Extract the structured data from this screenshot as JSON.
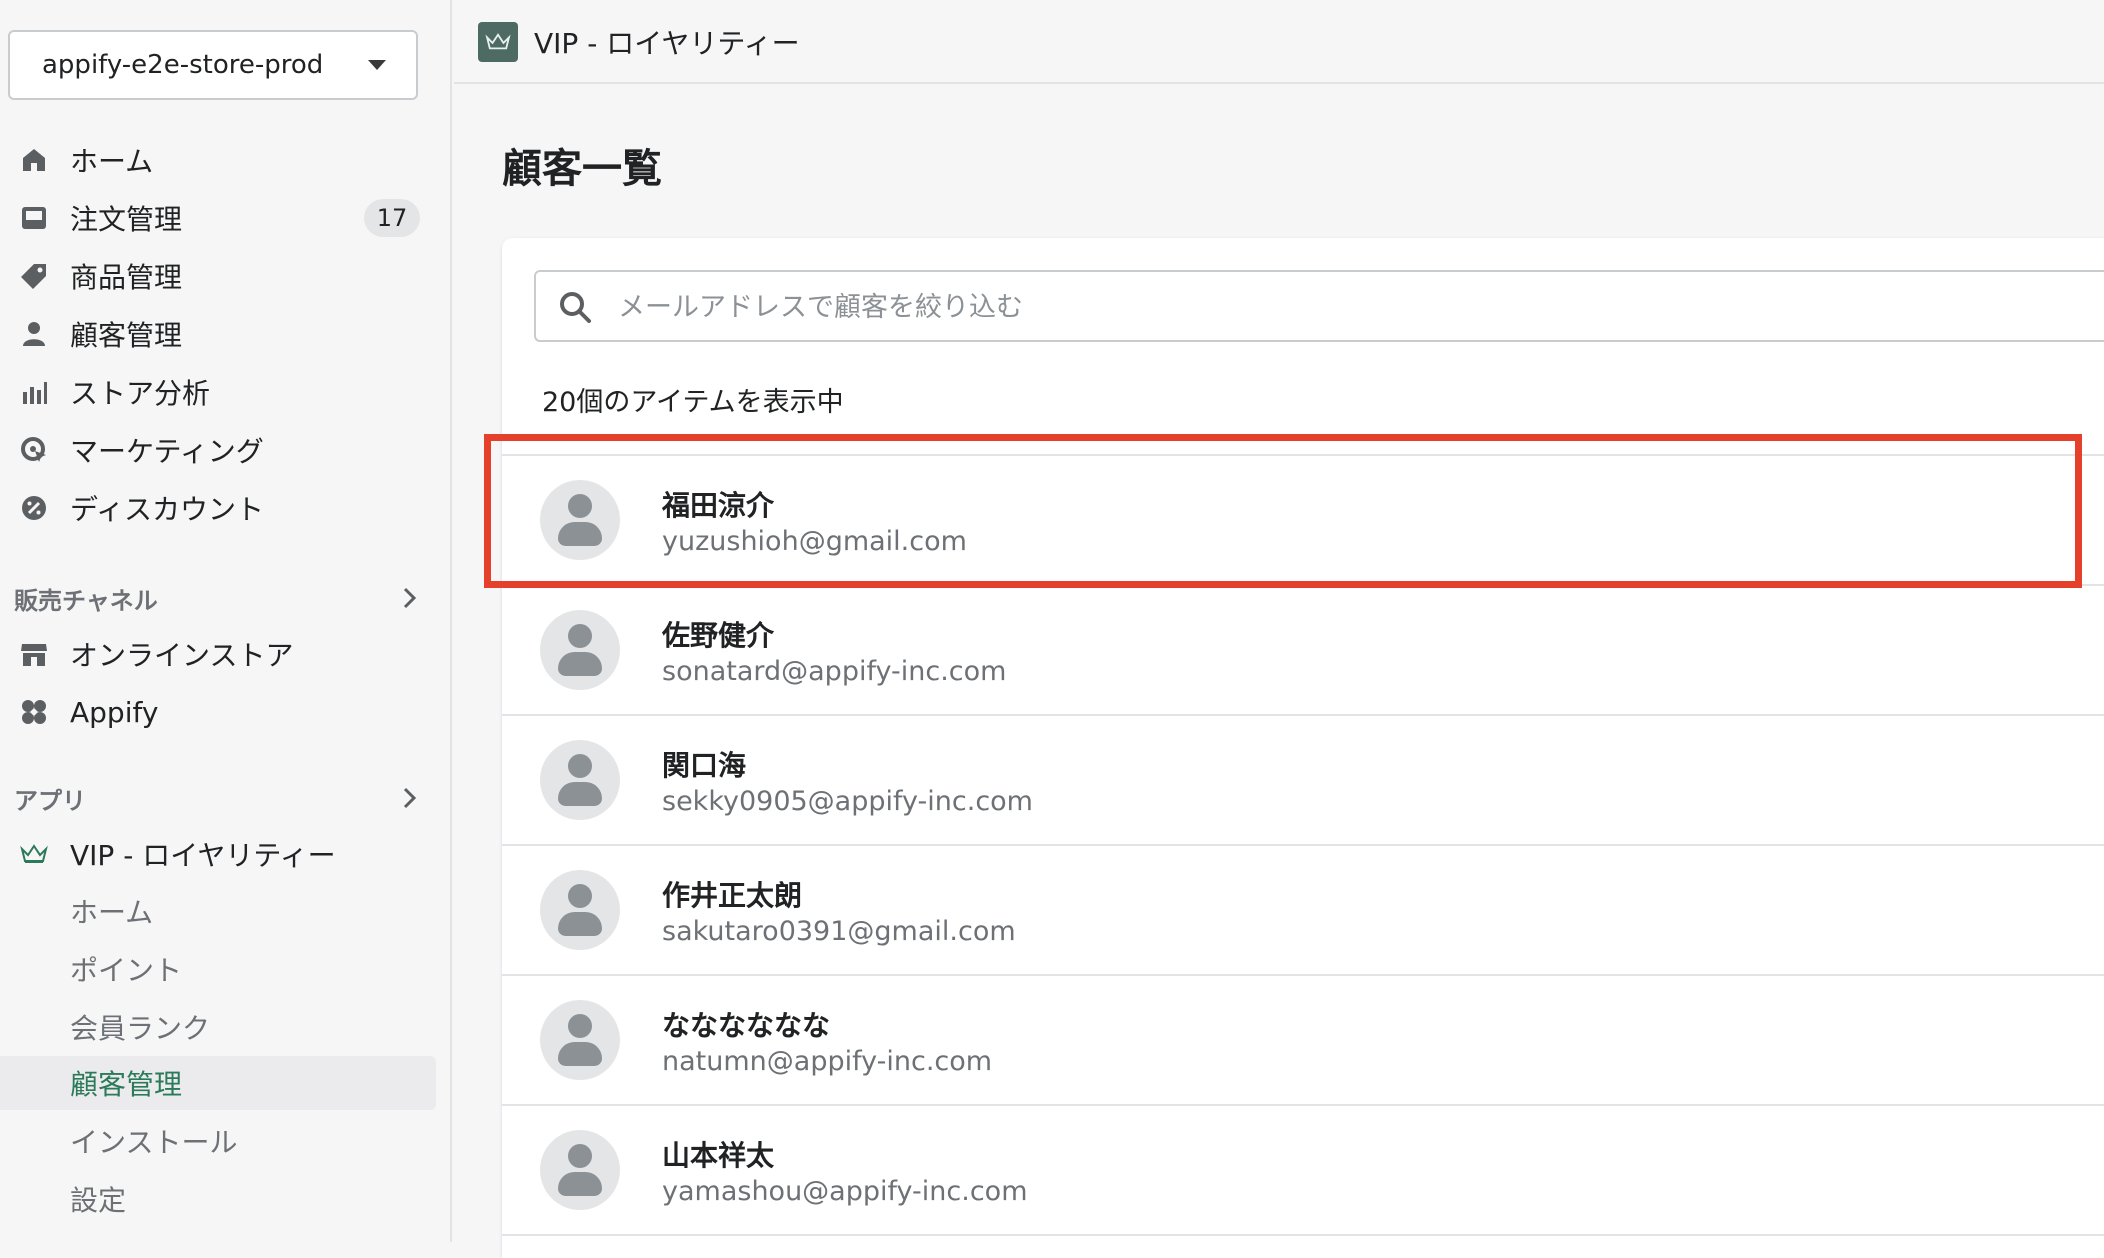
{
  "store": {
    "name": "appify-e2e-store-prod"
  },
  "nav": [
    {
      "label": "ホーム",
      "icon": "home-icon"
    },
    {
      "label": "注文管理",
      "icon": "inbox-icon",
      "badge": "17"
    },
    {
      "label": "商品管理",
      "icon": "tag-icon"
    },
    {
      "label": "顧客管理",
      "icon": "person-icon"
    },
    {
      "label": "ストア分析",
      "icon": "bar-chart-icon"
    },
    {
      "label": "マーケティング",
      "icon": "target-icon"
    },
    {
      "label": "ディスカウント",
      "icon": "discount-icon"
    }
  ],
  "sales_channels": {
    "heading": "販売チャネル",
    "items": [
      {
        "label": "オンラインストア",
        "icon": "store-icon"
      },
      {
        "label": "Appify",
        "icon": "appify-icon"
      }
    ]
  },
  "apps": {
    "heading": "アプリ",
    "app": {
      "label": "VIP - ロイヤリティー",
      "icon": "crown-icon"
    },
    "sub_items": [
      {
        "label": "ホーム"
      },
      {
        "label": "ポイント"
      },
      {
        "label": "会員ランク"
      },
      {
        "label": "顧客管理",
        "active": true
      },
      {
        "label": "インストール"
      },
      {
        "label": "設定"
      }
    ]
  },
  "topbar": {
    "title": "VIP - ロイヤリティー"
  },
  "page": {
    "title": "顧客一覧",
    "search_placeholder": "メールアドレスで顧客を絞り込む",
    "count_text": "20個のアイテムを表示中"
  },
  "customers": [
    {
      "name": "福田涼介",
      "email": "yuzushioh@gmail.com"
    },
    {
      "name": "佐野健介",
      "email": "sonatard@appify-inc.com"
    },
    {
      "name": "関口海",
      "email": "sekky0905@appify-inc.com"
    },
    {
      "name": "作井正太朗",
      "email": "sakutaro0391@gmail.com"
    },
    {
      "name": "なななななな",
      "email": "natumn@appify-inc.com"
    },
    {
      "name": "山本祥太",
      "email": "yamashou@appify-inc.com"
    }
  ],
  "colors": {
    "highlight": "#e5402b",
    "active_text": "#2b7a5a"
  }
}
